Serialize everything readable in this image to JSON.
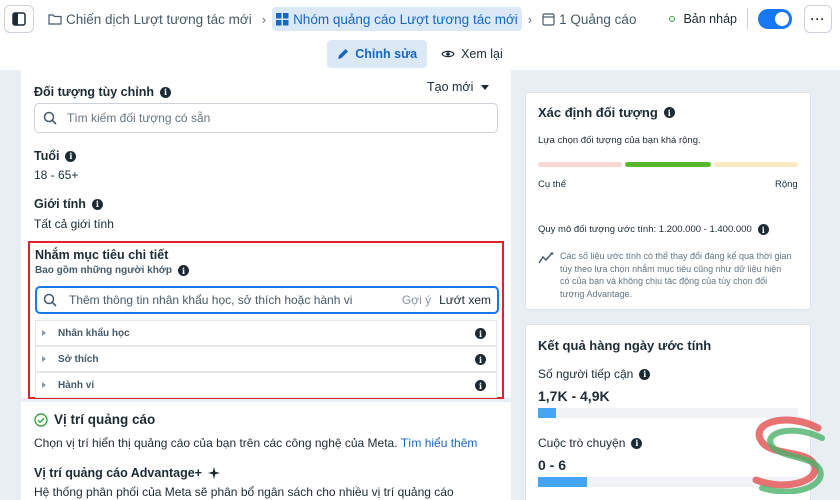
{
  "breadcrumb": {
    "campaign": "Chiến dịch Lượt tương tác mới",
    "adset": "Nhóm quảng cáo Lượt tương tác mới",
    "ad": "1 Quảng cáo"
  },
  "status": {
    "label": "Bản nháp",
    "toggle_on": true
  },
  "tabs": {
    "edit": "Chỉnh sửa",
    "review": "Xem lại"
  },
  "audience": {
    "custom_title": "Đối tượng tùy chỉnh",
    "create_new": "Tạo mới",
    "search_placeholder": "Tìm kiếm đối tượng có sẵn",
    "age_label": "Tuổi",
    "age_value": "18 - 65+",
    "gender_label": "Giới tính",
    "gender_value": "Tất cả giới tính"
  },
  "detailed_targeting": {
    "title": "Nhắm mục tiêu chi tiết",
    "subtitle": "Bao gồm những người khớp",
    "search_placeholder": "Thêm thông tin nhân khẩu học, sở thích hoặc hành vi",
    "suggest": "Gợi ý",
    "browse": "Lướt xem",
    "categories": [
      "Nhân khẩu học",
      "Sở thích",
      "Hành vi"
    ]
  },
  "placements": {
    "title": "Vị trí quảng cáo",
    "description": "Chọn vị trí hiển thị quảng cáo của bạn trên các công nghệ của Meta.",
    "learn_more": "Tìm hiểu thêm",
    "advantage_title": "Vị trí quảng cáo Advantage+",
    "advantage_desc": "Hệ thống phân phối của Meta sẽ phân bổ ngân sách cho nhiều vị trí quảng cáo"
  },
  "audience_definition": {
    "title": "Xác định đối tượng",
    "subtitle": "Lựa chọn đối tượng của bạn khá rộng.",
    "specific": "Cụ thể",
    "broad": "Rộng",
    "size_text": "Quy mô đối tượng ước tính: 1.200.000 - 1.400.000",
    "note": "Các số liệu ước tính có thể thay đổi đáng kể qua thời gian tùy theo lựa chọn nhắm mục tiêu cũng như dữ liệu hiện có của bạn và không chịu tác động của tùy chọn đối tượng Advantage.",
    "gauge_position": "middle-broad"
  },
  "daily_results": {
    "title": "Kết quả hàng ngày ước tính",
    "reach_label": "Số người tiếp cận",
    "reach_value": "1,7K - 4,9K",
    "reach_fraction": 0.07,
    "conversations_label": "Cuộc trò chuyện",
    "conversations_value": "0 - 6",
    "conversations_fraction": 0.19
  },
  "colors": {
    "accent": "#1877f2",
    "highlight_border": "#e0222a",
    "gauge_red": "#f8d7d6",
    "gauge_green": "#58b82b",
    "gauge_yellow": "#fcebc2",
    "bar_fill": "#42a5f5"
  }
}
